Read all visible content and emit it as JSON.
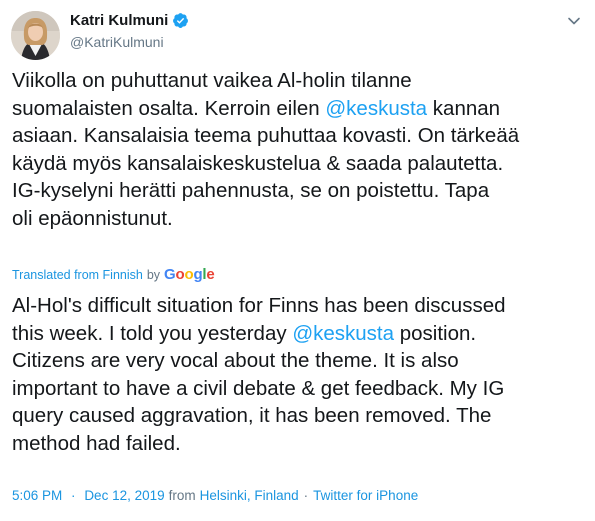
{
  "author": {
    "display_name": "Katri Kulmuni",
    "handle": "@KatriKulmuni",
    "verified": true
  },
  "tweet": {
    "original_lines": [
      [
        {
          "t": "Viikolla on puhuttanut vaikea Al-holin tilanne"
        }
      ],
      [
        {
          "t": "suomalaisten osalta. Kerroin eilen "
        },
        {
          "t": "@keskusta",
          "m": true
        },
        {
          "t": " kannan"
        }
      ],
      [
        {
          "t": "asiaan. Kansalaisia teema puhuttaa kovasti. On tärkeää"
        }
      ],
      [
        {
          "t": "käydä myös kansalaiskeskustelua & saada palautetta."
        }
      ],
      [
        {
          "t": "IG-kyselyni herätti pahennusta, se on poistettu. Tapa"
        }
      ],
      [
        {
          "t": "oli epäonnistunut."
        }
      ]
    ],
    "translated_from": "Translated from Finnish",
    "by": "by",
    "translator": "Google",
    "translation_lines": [
      [
        {
          "t": "Al-Hol's difficult situation for Finns has been discussed"
        }
      ],
      [
        {
          "t": "this week. I told you yesterday "
        },
        {
          "t": "@keskusta",
          "m": true
        },
        {
          "t": " position."
        }
      ],
      [
        {
          "t": "Citizens are very vocal about the theme. It is also"
        }
      ],
      [
        {
          "t": "important to have a civil debate & get feedback. My IG"
        }
      ],
      [
        {
          "t": "query caused aggravation, it has been removed. The"
        }
      ],
      [
        {
          "t": "method had failed."
        }
      ]
    ]
  },
  "meta": {
    "time": "5:06 PM",
    "date": "Dec 12, 2019",
    "from_word": "from",
    "location": "Helsinki, Finland",
    "source": "Twitter for iPhone"
  },
  "colors": {
    "link": "#1da1f2",
    "secondary_text": "#657786",
    "google_blue": "#4285f4",
    "google_red": "#ea4335",
    "google_yellow": "#fbbc05",
    "google_green": "#34a853"
  },
  "icons": {
    "verified": "verified-badge-icon",
    "menu": "chevron-down-icon"
  }
}
